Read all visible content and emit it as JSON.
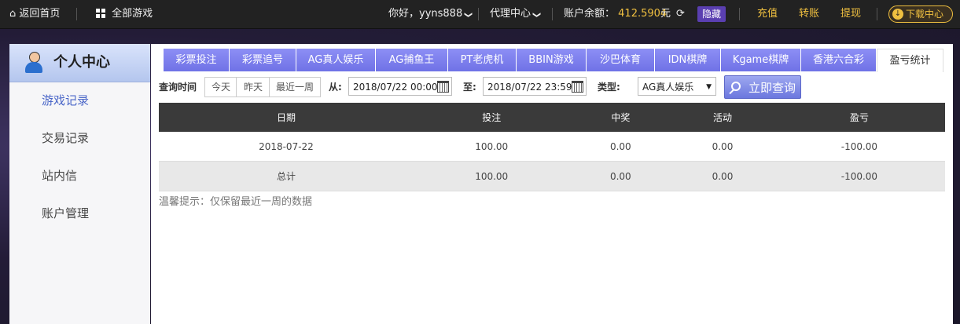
{
  "topbar": {
    "home": "返回首页",
    "all_games": "全部游戏",
    "greeting": "你好，yyns888",
    "agent_center": "代理中心",
    "balance_label": "账户余额：",
    "balance_amount": "412.5904",
    "balance_unit": "元",
    "hide": "隐藏",
    "recharge": "充值",
    "transfer": "转账",
    "withdraw": "提现",
    "download": "下载中心"
  },
  "sidebar": {
    "title": "个人中心",
    "items": [
      {
        "label": "游戏记录",
        "active": true
      },
      {
        "label": "交易记录",
        "active": false
      },
      {
        "label": "站内信",
        "active": false
      },
      {
        "label": "账户管理",
        "active": false
      }
    ]
  },
  "tabs": [
    {
      "label": "彩票投注"
    },
    {
      "label": "彩票追号"
    },
    {
      "label": "AG真人娱乐"
    },
    {
      "label": "AG捕鱼王"
    },
    {
      "label": "PT老虎机"
    },
    {
      "label": "BBIN游戏"
    },
    {
      "label": "沙巴体育"
    },
    {
      "label": "IDN棋牌"
    },
    {
      "label": "Kgame棋牌"
    },
    {
      "label": "香港六合彩"
    },
    {
      "label": "盈亏统计",
      "active": true
    }
  ],
  "filters": {
    "query_time_label": "查询时间",
    "today": "今天",
    "yesterday": "昨天",
    "last_week": "最近一周",
    "from_label": "从:",
    "from_value": "2018/07/22 00:00",
    "to_label": "至:",
    "to_value": "2018/07/22 23:59",
    "type_label": "类型:",
    "type_value": "AG真人娱乐",
    "search_button": "立即查询"
  },
  "table": {
    "headers": [
      "日期",
      "投注",
      "中奖",
      "活动",
      "盈亏"
    ],
    "rows": [
      [
        "2018-07-22",
        "100.00",
        "0.00",
        "0.00",
        "-100.00"
      ]
    ],
    "total": [
      "总计",
      "100.00",
      "0.00",
      "0.00",
      "-100.00"
    ]
  },
  "tip": "温馨提示：仅保留最近一周的数据"
}
